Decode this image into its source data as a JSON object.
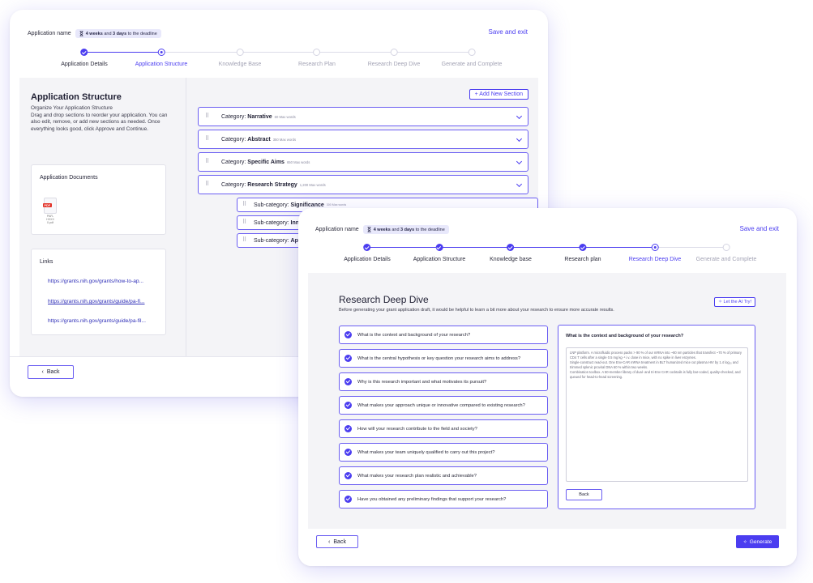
{
  "back_window": {
    "header": {
      "app_name_label": "Application name",
      "deadline_bold_a": "4 weeks",
      "deadline_mid": " and ",
      "deadline_bold_b": "3 days",
      "deadline_tail": " to the deadline",
      "save_exit": "Save and exit"
    },
    "steps": [
      {
        "label": "Application Details",
        "state": "done"
      },
      {
        "label": "Application Structure",
        "state": "current"
      },
      {
        "label": "Knowledge Base",
        "state": "todo"
      },
      {
        "label": "Research Plan",
        "state": "todo"
      },
      {
        "label": "Research Deep Dive",
        "state": "todo"
      },
      {
        "label": "Generate and Complete",
        "state": "todo"
      }
    ],
    "left_panel": {
      "title": "Application Structure",
      "description": "Organize Your Application Structure\nDrag and drop sections to reorder your application. You can also edit, remove, or add new sections as needed. Once everything looks good, click Approve and Continue.",
      "documents_title": "Application Documents",
      "pdf_tag": "PDF",
      "pdf_filename": "PAR-HXXX 0.pdf",
      "links_title": "Links",
      "links": [
        "https://grants.nih.gov/grants/how-to-ap...",
        "https://grants.nih.gov/grants/guide/pa-fi...",
        "https://grants.nih.gov/grants/guide/pa-fil..."
      ]
    },
    "add_section": "+ Add New Section",
    "categories": [
      {
        "prefix": "Category: ",
        "name": "Narrative",
        "max_words": "60 Max words"
      },
      {
        "prefix": "Category: ",
        "name": "Abstract",
        "max_words": "350 Max words"
      },
      {
        "prefix": "Category: ",
        "name": "Specific Aims",
        "max_words": "650 Max words"
      },
      {
        "prefix": "Category: ",
        "name": "Research Strategy",
        "max_words": "1,200 Max words"
      }
    ],
    "subcategories": [
      {
        "prefix": "Sub-category: ",
        "name": "Significance",
        "max_words": "300 Max words"
      },
      {
        "prefix": "Sub-category: ",
        "name": "Innovat"
      },
      {
        "prefix": "Sub-category: ",
        "name": "Approac"
      }
    ],
    "back_label": "Back"
  },
  "front_window": {
    "header": {
      "app_name_label": "Application name",
      "deadline_bold_a": "4 weeks",
      "deadline_mid": " and ",
      "deadline_bold_b": "3 days",
      "deadline_tail": " to the deadline",
      "save_exit": "Save and exit"
    },
    "steps": [
      {
        "label": "Application Details",
        "state": "done"
      },
      {
        "label": "Application Structure",
        "state": "done"
      },
      {
        "label": "Knowledge base",
        "state": "done"
      },
      {
        "label": "Research plan",
        "state": "done"
      },
      {
        "label": "Research Deep Dive",
        "state": "current"
      },
      {
        "label": "Generate and Complete",
        "state": "todo"
      }
    ],
    "title": "Research Deep Dive",
    "description": "Before generating your grant application draft, it would be helpful to learn a bit more about your research to ensure more accurate results.",
    "ai_try": "Let the AI Try!",
    "questions": [
      "What is the context and background of your research?",
      "What is the central hypothesis or key question your research aims to address?",
      "Why is this research important and what motivates its pursuit?",
      "What makes your approach unique or innovative compared to existing research?",
      "How will your research contribute to the field and society?",
      "What makes your team uniquely qualified to carry out this project?",
      "What makes your research plan realistic and achievable?",
      "Have you obtained any preliminary findings that support your research?"
    ],
    "answer_title": "What is the context and background of your research?",
    "answer_text": "LNP platform. A microfluidic process packs > 90 % of our mRNA into ~80 nm particles that transfect ~70 % of primary CD4 T cells after a single 0.5 mg kg⁻¹ i.v. dose in mice, with no spike in liver enzymes.\nSingle-construct read-out. One Env-CAR mRNA treatment in BLT humanized mice cut plasma HIV by 1.4 log₁₀ and trimmed splenic proviral DNA 60 % within two weeks.\nCombination toolbox. A 50-member library of dual- and tri-Env CAR cocktails is fully bar-coded, quality-checked, and queued for head-to-head screening.",
    "answer_back": "Back",
    "back_label": "Back",
    "generate_label": "Generate"
  },
  "colors": {
    "accent": "#4b3df0",
    "pdf_red": "#e2342a"
  }
}
